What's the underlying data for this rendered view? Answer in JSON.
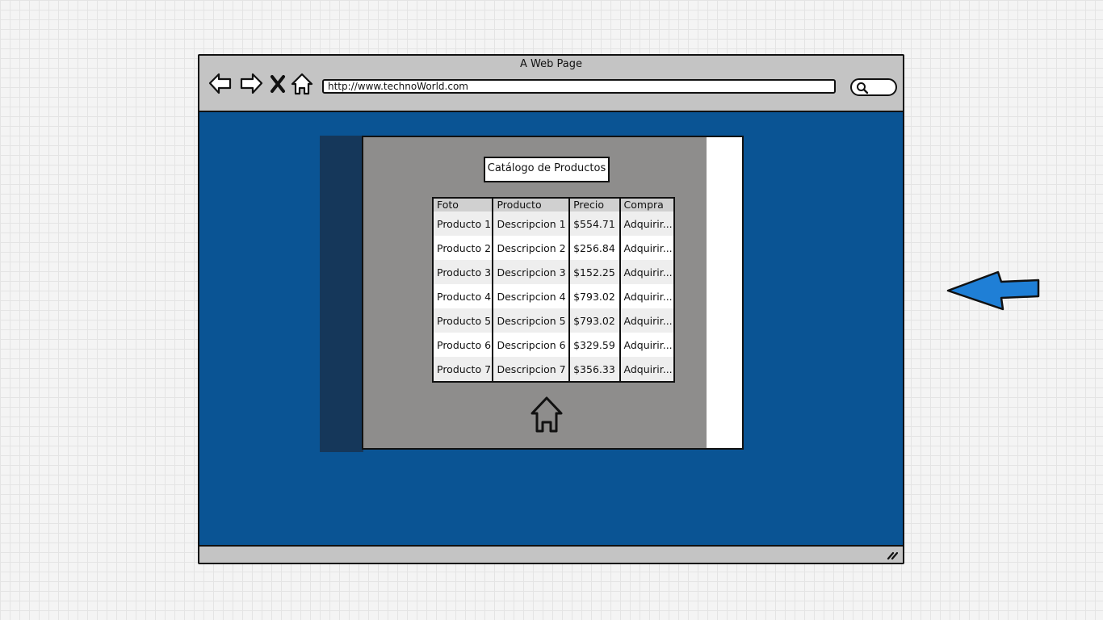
{
  "browser": {
    "window_title": "A Web Page",
    "url": "http://www.technoWorld.com"
  },
  "catalog": {
    "title": "Catálogo de Productos",
    "columns": [
      "Foto",
      "Producto",
      "Precio",
      "Compra"
    ],
    "rows": [
      {
        "foto": "Producto 1",
        "producto": "Descripcion 1",
        "precio": "$554.71",
        "compra": "Adquirir..."
      },
      {
        "foto": "Producto 2",
        "producto": "Descripcion 2",
        "precio": "$256.84",
        "compra": "Adquirir..."
      },
      {
        "foto": "Producto 3",
        "producto": "Descripcion 3",
        "precio": "$152.25",
        "compra": "Adquirir..."
      },
      {
        "foto": "Producto 4",
        "producto": "Descripcion 4",
        "precio": "$793.02",
        "compra": "Adquirir..."
      },
      {
        "foto": "Producto 5",
        "producto": "Descripcion 5",
        "precio": "$793.02",
        "compra": "Adquirir..."
      },
      {
        "foto": "Producto 6",
        "producto": "Descripcion 6",
        "precio": "$329.59",
        "compra": "Adquirir..."
      },
      {
        "foto": "Producto 7",
        "producto": "Descripcion 7",
        "precio": "$356.33",
        "compra": "Adquirir..."
      }
    ]
  },
  "icons": {
    "back": "arrow-left-icon",
    "forward": "arrow-right-icon",
    "stop": "close-icon",
    "home": "home-icon",
    "search": "search-icon",
    "resize": "resize-grip-icon",
    "pointer": "arrow-pointer-icon"
  },
  "colors": {
    "viewport_bg": "#0a5494",
    "chrome": "#c4c4c4",
    "panel_bg": "#8e8d8c",
    "dark_strip": "#15375a",
    "pointer_arrow": "#1f7fd6"
  }
}
